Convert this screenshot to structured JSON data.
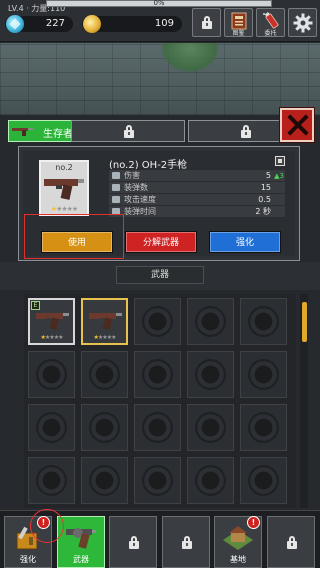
{
  "status": {
    "level_text": "LV.4 · 力量:110",
    "xp_percent_text": "0%",
    "xp_fraction": 0.0,
    "gems": "227",
    "coins": "109"
  },
  "top_buttons": [
    {
      "icon": "lock-icon",
      "label": ""
    },
    {
      "icon": "book-icon",
      "label": "图鉴"
    },
    {
      "icon": "spray-can-icon",
      "label": "委托"
    },
    {
      "icon": "gear-icon",
      "label": ""
    }
  ],
  "character_tabs": [
    {
      "label": "生存者",
      "active": true,
      "locked": false
    },
    {
      "label": "",
      "active": false,
      "locked": true
    },
    {
      "label": "",
      "active": false,
      "locked": true
    }
  ],
  "weapon": {
    "slot_number": "no.2",
    "name": "(no.2) OH-2手枪",
    "stars": 5,
    "stars_filled": 1,
    "stats": [
      {
        "label": "伤害",
        "value": "5",
        "delta": "▲3"
      },
      {
        "label": "装弹数",
        "value": "15",
        "delta": ""
      },
      {
        "label": "攻击速度",
        "value": "0.5",
        "delta": ""
      },
      {
        "label": "装弹时间",
        "value": "2 秒",
        "delta": ""
      }
    ]
  },
  "actions": {
    "use": "使用",
    "disassemble": "分解武器",
    "upgrade": "强化"
  },
  "category_label": "武器",
  "inventory": {
    "columns": 5,
    "rows": 4,
    "items": [
      {
        "type": "pistol",
        "equipped": true,
        "selected": false,
        "stars_filled": 1,
        "equip_mark": "E"
      },
      {
        "type": "pistol",
        "equipped": false,
        "selected": true,
        "stars_filled": 1,
        "equip_mark": ""
      }
    ],
    "scroll_position_fraction": 0.0
  },
  "bottom_nav": [
    {
      "label": "强化",
      "icon": "upgrade-icon",
      "active": false,
      "locked": false,
      "badge": "!"
    },
    {
      "label": "武器",
      "icon": "revolver-icon",
      "active": true,
      "locked": false,
      "badge": ""
    },
    {
      "label": "",
      "icon": "lock-icon",
      "active": false,
      "locked": true,
      "badge": ""
    },
    {
      "label": "",
      "icon": "lock-icon",
      "active": false,
      "locked": true,
      "badge": ""
    },
    {
      "label": "基地",
      "icon": "base-icon",
      "active": false,
      "locked": false,
      "badge": "!"
    },
    {
      "label": "",
      "icon": "lock-icon",
      "active": false,
      "locked": true,
      "badge": ""
    }
  ],
  "colors": {
    "active_green": "#2bb33a",
    "use_orange": "#d69114",
    "disassemble_red": "#cf2223",
    "upgrade_blue": "#1f6fd7",
    "select_gold": "#e7c24d",
    "close_red": "#b8201c"
  }
}
